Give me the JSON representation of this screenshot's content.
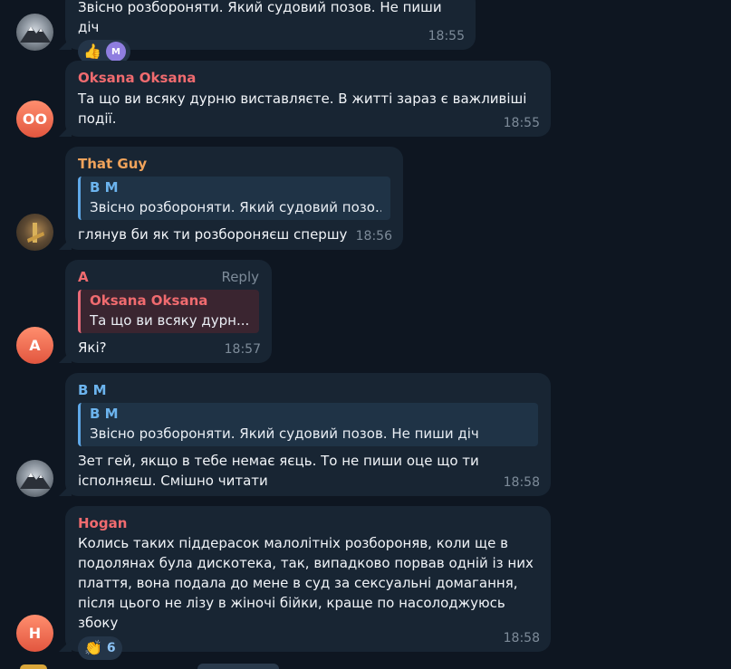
{
  "colors": {
    "background": "#0e1621",
    "bubble": "#182533",
    "name_red": "#f06b6f",
    "name_orange": "#f0a35b",
    "name_blue": "#6cb4ee",
    "time": "#7d8b99"
  },
  "messages": [
    {
      "avatar_icon": "mountain-avatar",
      "text": "Звісно розбороняти. Який судовий позов. Не пиши діч",
      "reactions": [
        {
          "icon": "thumbs-up-icon",
          "glyph": "👍"
        },
        {
          "icon": "reactor-avatar",
          "initial": "M"
        }
      ],
      "time": "18:55"
    },
    {
      "avatar_initials": "OO",
      "sender": "Oksana Oksana",
      "text_line1": "Та що ви всяку дурню виставляєте. В житті зараз є важливіші",
      "text_line2": "події.",
      "time": "18:55"
    },
    {
      "avatar_icon": "that-guy-avatar",
      "sender": "That Guy",
      "quote": {
        "name": "B M",
        "text": "Звісно розбороняти. Який судовий позо..."
      },
      "text": "глянув би як ти розбороняєш спершу",
      "time": "18:56"
    },
    {
      "avatar_initials": "A",
      "sender": "A",
      "reply_label": "Reply",
      "quote": {
        "name": "Oksana Oksana",
        "text": "Та що ви всяку дурн..."
      },
      "text": "Які?",
      "time": "18:57"
    },
    {
      "avatar_icon": "mountain-avatar",
      "sender": "B M",
      "quote": {
        "name": "B M",
        "text": "Звісно розбороняти. Який судовий позов. Не пиши діч"
      },
      "text_line1": "Зет гей, якщо в тебе немає яєць. То не пиши оце що ти",
      "text_line2": "ісполняєш. Смішно читати",
      "time": "18:58"
    },
    {
      "avatar_initials": "H",
      "sender": "Hogan",
      "text_lines": [
        "Колись таких піддерасок малолітніх розбороняв, коли ще в",
        "подолянах була дискотека, так, випадково порвав одній із них",
        "плаття, вона подала до мене в суд за сексуальні домагання,",
        "після цього не лізу в жіночі бійки, краще по насолоджуюсь збоку"
      ],
      "reaction": {
        "icon": "clapping-hands-icon",
        "glyph": "👏",
        "count": "6"
      },
      "time": "18:58"
    }
  ]
}
